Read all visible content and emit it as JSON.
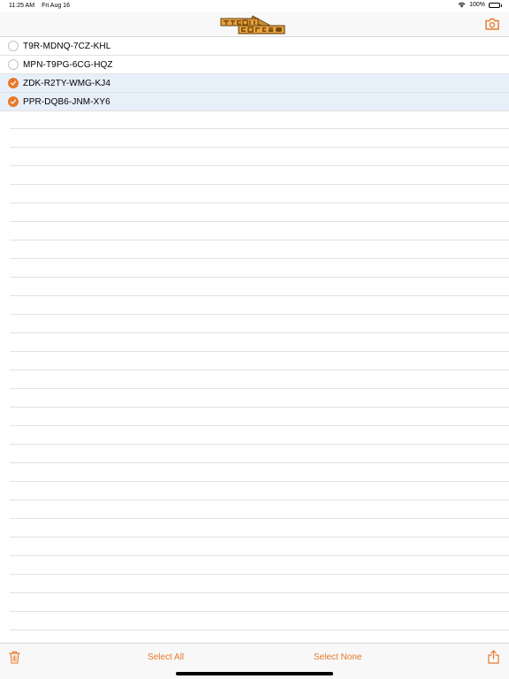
{
  "status_bar": {
    "time": "11:25 AM",
    "date": "Fri Aug 16",
    "battery": "100%"
  },
  "nav": {
    "logo_icon": "tycoon-cards-logo",
    "camera_icon": "camera-icon"
  },
  "codes": [
    {
      "code": "T9R-MDNQ-7CZ-KHL",
      "selected": false
    },
    {
      "code": "MPN-T9PG-6CG-HQZ",
      "selected": false
    },
    {
      "code": "ZDK-R2TY-WMG-KJ4",
      "selected": true
    },
    {
      "code": "PPR-DQB6-JNM-XY6",
      "selected": true
    }
  ],
  "toolbar": {
    "select_all": "Select All",
    "select_none": "Select None",
    "trash_icon": "trash-icon",
    "share_icon": "share-icon"
  },
  "colors": {
    "accent": "#e8782b",
    "selected_row": "#e7eff9"
  }
}
